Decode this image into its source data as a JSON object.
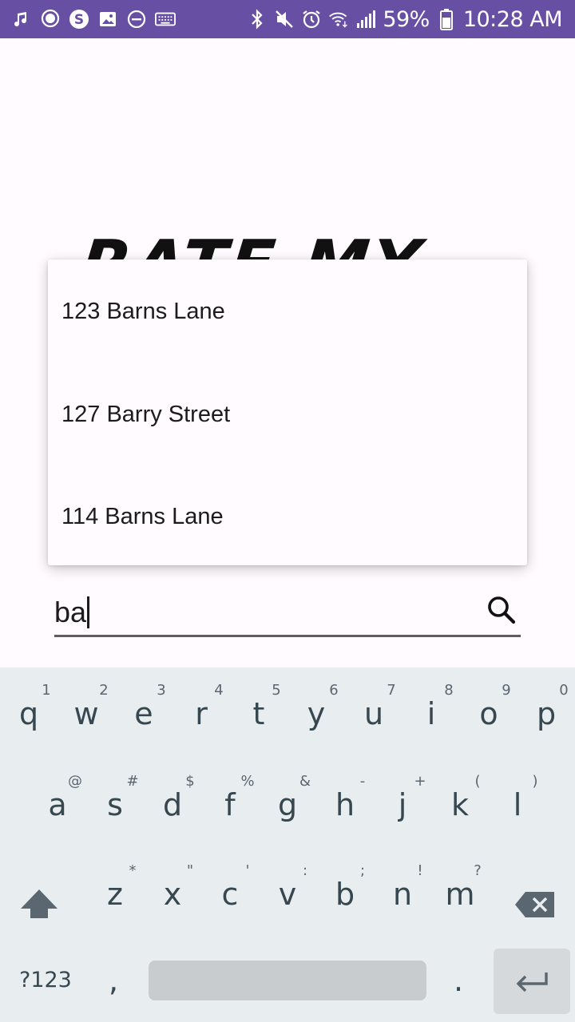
{
  "status_bar": {
    "battery_percent": "59%",
    "time": "10:28 AM",
    "left_icons": [
      "music-note-icon",
      "chat-bubble-icon",
      "skype-icon",
      "image-icon",
      "do-not-disturb-icon",
      "keyboard-icon"
    ],
    "right_icons": [
      "bluetooth-icon",
      "mute-icon",
      "alarm-icon",
      "wifi-icon",
      "signal-icon",
      "battery-icon"
    ]
  },
  "headline": {
    "text": "RATE MY"
  },
  "suggestions": [
    {
      "label": "123 Barns Lane"
    },
    {
      "label": "127 Barry Street"
    },
    {
      "label": "114 Barns Lane"
    }
  ],
  "search": {
    "value": "ba",
    "icon": "search-icon"
  },
  "keyboard": {
    "row1": [
      {
        "key": "q",
        "hint": "1"
      },
      {
        "key": "w",
        "hint": "2"
      },
      {
        "key": "e",
        "hint": "3"
      },
      {
        "key": "r",
        "hint": "4"
      },
      {
        "key": "t",
        "hint": "5"
      },
      {
        "key": "y",
        "hint": "6"
      },
      {
        "key": "u",
        "hint": "7"
      },
      {
        "key": "i",
        "hint": "8"
      },
      {
        "key": "o",
        "hint": "9"
      },
      {
        "key": "p",
        "hint": "0"
      }
    ],
    "row2": [
      {
        "key": "a",
        "hint": "@"
      },
      {
        "key": "s",
        "hint": "#"
      },
      {
        "key": "d",
        "hint": "$"
      },
      {
        "key": "f",
        "hint": "%"
      },
      {
        "key": "g",
        "hint": "&"
      },
      {
        "key": "h",
        "hint": "-"
      },
      {
        "key": "j",
        "hint": "+"
      },
      {
        "key": "k",
        "hint": "("
      },
      {
        "key": "l",
        "hint": ")"
      }
    ],
    "row3": [
      {
        "key": "z",
        "hint": "*"
      },
      {
        "key": "x",
        "hint": "\""
      },
      {
        "key": "c",
        "hint": "'"
      },
      {
        "key": "v",
        "hint": ":"
      },
      {
        "key": "b",
        "hint": ";"
      },
      {
        "key": "n",
        "hint": "!"
      },
      {
        "key": "m",
        "hint": "?"
      }
    ],
    "symbols_label": "?123",
    "comma": ",",
    "period": ".",
    "shift_icon": "shift-icon",
    "backspace_icon": "backspace-icon",
    "enter_icon": "enter-icon"
  },
  "colors": {
    "status_bar": "#6750a4",
    "background": "#fffbfe",
    "keyboard": "#e8eef0",
    "key_text": "#37474f"
  }
}
